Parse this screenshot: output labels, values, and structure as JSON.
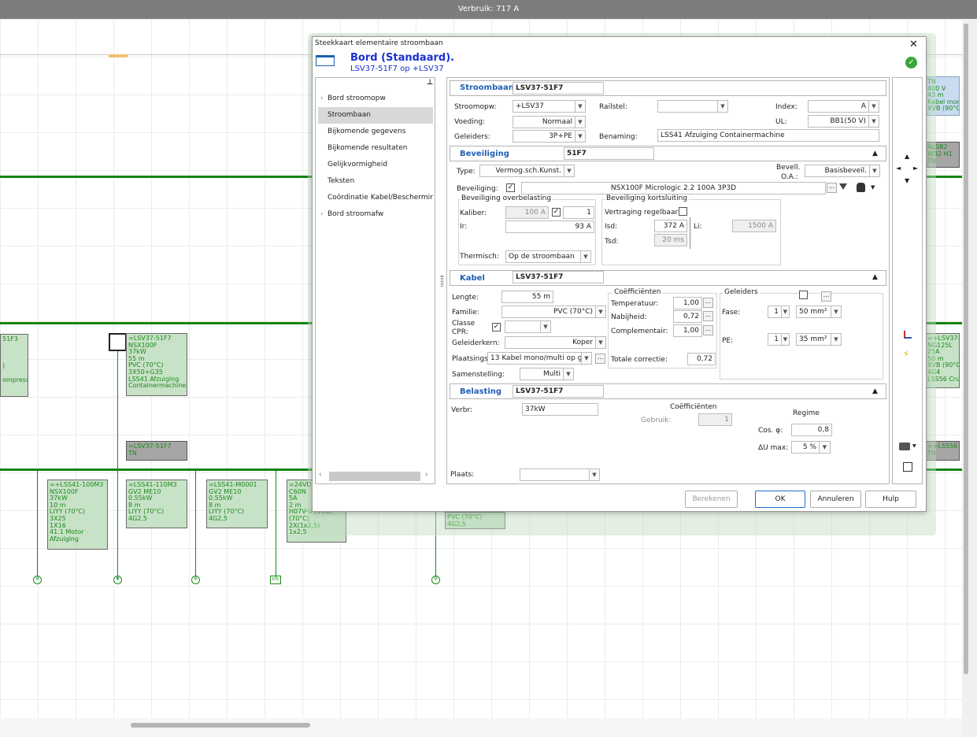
{
  "status": {
    "consumption": "Verbruik: 717 A"
  },
  "diagram": {
    "box_lsv_f1": "=LSV37-51F7\nNSX100F\n37kW\n55 m\nPVC (70°C)\n3X50+G35\nLSS41 Afzuiging\nContainermachine",
    "box_lsv_f1_short": "=LSV37-51F7\nTN",
    "box_left": "51F3\n\n\n\n)\n\nompresso",
    "box_m3": "=+LSS41-100M3\nNSX100F\n37kW\n10 m\nLIYY (70°C)\n3X25\n1X16\n41.1 Motor\nAfzuiging",
    "box_m3b": "=LSS41-110M3\nGV2 ME10\n0.55kW\n8 m\nLIYY (70°C)\n4G2,5",
    "box_m0001": "=LSS41-M0001\nGV2 ME10\n0.55kW\n8 m\nLIYY (70°C)\n4G2,5",
    "box_24vdc": "=24VDC\nC60N\n5A\n2 m\nH07V-U (VOB)\n(70°C)\n2X(1x2,5)\n1x2,5",
    "box_under": "PVC (70°C)\n4G2,5",
    "box_right1": "TN\n400 V\n43 m\nKabel mono\nXVB (90°C)",
    "box_right2": "ALSB2\nW32 H1\nTN",
    "box_right3": "=+LSV37-5\nNG125L\n25A\n50 m\nXVB (90°C)\n4G4\nLSS56 Crus",
    "box_right4": "=+LSS56\nTN",
    "circle_m": "M",
    "div_label": "DIV"
  },
  "dialog": {
    "window_title": "Steekkaart elementaire stroombaan",
    "header_title": "Bord (Standaard).",
    "header_subtitle": "LSV37-51F7 op +LSV37",
    "nav": [
      "Bord stroomopw",
      "Stroombaan",
      "Bijkomende gegevens",
      "Bijkomende resultaten",
      "Gelijkvormigheid",
      "Teksten",
      "Coördinatie Kabel/Bescherming",
      "Bord stroomafw"
    ],
    "stroombaan": {
      "title": "Stroombaan",
      "name": "LSV37-51F7",
      "stroomopw_label": "Stroomopw:",
      "stroomopw": "+LSV37",
      "voeding_label": "Voeding:",
      "voeding": "Normaal",
      "geleiders_label": "Geleiders:",
      "geleiders": "3P+PE",
      "railstel_label": "Railstel:",
      "railstel": "",
      "benaming_label": "Benaming:",
      "benaming": "LSS41 Afzuiging Containermachine",
      "index_label": "Index:",
      "index": "A",
      "ul_label": "UL:",
      "ul": "BB1(50 V)"
    },
    "beveiliging": {
      "title": "Beveiliging",
      "name": "51F7",
      "type_label": "Type:",
      "type": "Vermog.sch.Kunst.",
      "bevoa_label_1": "Bevell.",
      "bevoa_label_2": "O.A.:",
      "bevoa": "Basisbeveil.",
      "beveiliging_label": "Beveiliging:",
      "beveiliging": "NSX100F Micrologic 2.2  100A 3P3D",
      "overbelasting_title": "Beveiliging overbelasting",
      "kaliber_label": "Kaliber:",
      "kaliber": "100 A",
      "kaliber_n": "1",
      "ir_label": "Ir:",
      "ir": "93 A",
      "thermisch_label": "Thermisch:",
      "thermisch": "Op de stroombaan",
      "kortsluiting_title": "Beveiliging kortsluiting",
      "vertraging_label": "Vertraging regelbaar",
      "isd_label": "Isd:",
      "isd": "372 A",
      "tsd_label": "Tsd:",
      "tsd": "20 ms",
      "li_label": "Li:",
      "li": "1500 A"
    },
    "kabel": {
      "title": "Kabel",
      "name": "LSV37-51F7",
      "lengte_label": "Lengte:",
      "lengte": "55 m",
      "familie_label": "Familie:",
      "familie": "PVC (70°C)",
      "cpr_label_1": "Classe",
      "cpr_label_2": "CPR:",
      "geleiderkern_label": "Geleiderkern:",
      "geleiderkern": "Koper",
      "plaatsing_label": "Plaatsings.",
      "plaatsing": "13  Kabel mono/multi op g",
      "samenstelling_label": "Samenstelling:",
      "samenstelling": "Multi",
      "coef_title": "Coëfficiënten",
      "temp_label": "Temperatuur:",
      "temp": "1,00",
      "nab_label": "Nabijheid:",
      "nab": "0,72",
      "compl_label": "Complementair:",
      "compl": "1,00",
      "totaal_label": "Totale correctie:",
      "totaal": "0,72",
      "gel_title": "Geleiders",
      "fase_label": "Fase:",
      "fase_n": "1",
      "fase": "50 mm²",
      "pe_label": "PE:",
      "pe_n": "1",
      "pe": "35 mm²"
    },
    "belasting": {
      "title": "Belasting",
      "name": "LSV37-51F7",
      "verbr_label": "Verbr:",
      "verbr": "37kW",
      "coef_title": "Coëfficiënten",
      "gebruik_label": "Gebruik:",
      "gebruik": "1",
      "regime_title": "Regime",
      "cos_label": "Cos. φ:",
      "cos": "0,8",
      "du_label": "ΔU max:",
      "du": "5 %"
    },
    "plaats_label": "Plaats:",
    "plaats": "",
    "buttons": {
      "berekenen": "Berekenen",
      "ok": "OK",
      "annuleren": "Annuleren",
      "hulp": "Hulp"
    },
    "glyphs": {
      "close": "✕",
      "check": "✓",
      "collapse": "▲",
      "dd": "▼",
      "dots": "...",
      "chev": "›",
      "up": "▲",
      "down": "▼",
      "left": "◄",
      "right": "►",
      "pin": "⊥",
      "lightning": "⚡"
    }
  },
  "colors": {
    "accent": "#1f5fb4",
    "title_blue": "#1a2fd0",
    "green": "#128512",
    "ok_green": "#3aa53a"
  }
}
